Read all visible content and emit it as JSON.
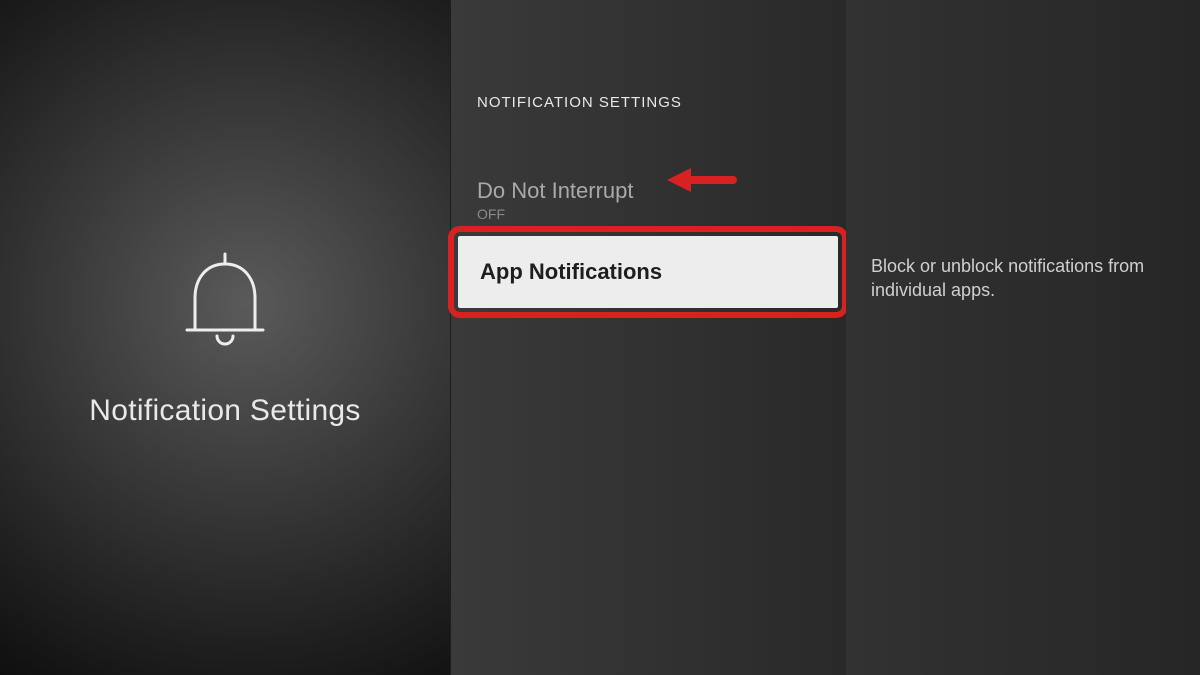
{
  "left": {
    "title": "Notification Settings"
  },
  "mid": {
    "header": "NOTIFICATION SETTINGS",
    "items": {
      "dni": {
        "label": "Do Not Interrupt",
        "sub": "OFF"
      },
      "app": {
        "label": "App Notifications"
      }
    }
  },
  "right": {
    "description": "Block or unblock notifications from individual apps."
  },
  "annotation": {
    "highlight_color": "#d82222"
  }
}
